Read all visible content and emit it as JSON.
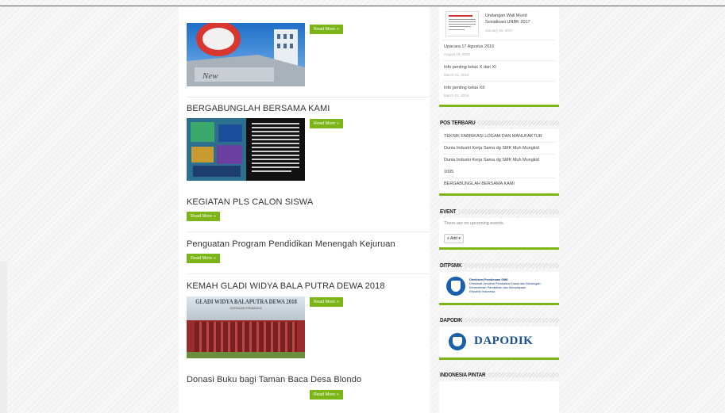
{
  "main": {
    "read_more": "Read More »",
    "posts": [
      {
        "title": ""
      },
      {
        "title": "BERGABUNGLAH BERSAMA KAMI"
      },
      {
        "title": "KEGIATAN PLS CALON SISWA"
      },
      {
        "title": "Penguatan Program Pendidikan Menengah Kejuruan"
      },
      {
        "title": "KEMAH GLADI WIDYA BALA PUTRA DEWA 2018"
      },
      {
        "title": "Donasi Buku bagi Taman Baca Desa Blondo"
      }
    ],
    "kemah_banner": "GLADI WIDYA BALAPUTRA DEWA 2018",
    "kemah_sub": "GERAKAN PRAMUKA"
  },
  "sidebar": {
    "recent": {
      "items": [
        {
          "title": "Undangan Wali Murid",
          "title2": "Sosialisasi UNBK 2017",
          "date": "January 26, 2017"
        },
        {
          "title": "Upacara 17 Agustus 2016",
          "date": "August 18, 2016"
        },
        {
          "title": "Info penting kelas X dan XI",
          "date": "March 21, 2016"
        },
        {
          "title": "Info penting kelas XII",
          "date": "March 21, 2016"
        }
      ]
    },
    "pos_terbaru": {
      "title": "POS TERBARU",
      "items": [
        "TEKNIK FABRIKASI LOGAM DAN MANUFAKTUR",
        "Dunia Industri Kerja Sama dg SMK Muh Mungkid",
        "Dunia Industri Kerja Sama dg SMK Muh Mungkid",
        "1005",
        "BERGABUNGLAH BERSAMA KAMI"
      ]
    },
    "event": {
      "title": "EVENT",
      "empty_text": "There are no upcoming events.",
      "add_button": "Add"
    },
    "ditpsmk": {
      "title": "DITPSMK",
      "line1": "Direktorat Pembinaan SMK",
      "line2": "Direktorat Jenderal Pendidikan Dasar dan Menengah",
      "line3": "Kementerian Pendidikan dan Kebudayaan",
      "line4": "Republik Indonesia"
    },
    "dapodik": {
      "title": "DAPODIK",
      "logo_text": "DAPODIK"
    },
    "indonesia_pintar": {
      "title": "INDONESIA PINTAR"
    }
  },
  "colors": {
    "accent": "#7cb518"
  }
}
